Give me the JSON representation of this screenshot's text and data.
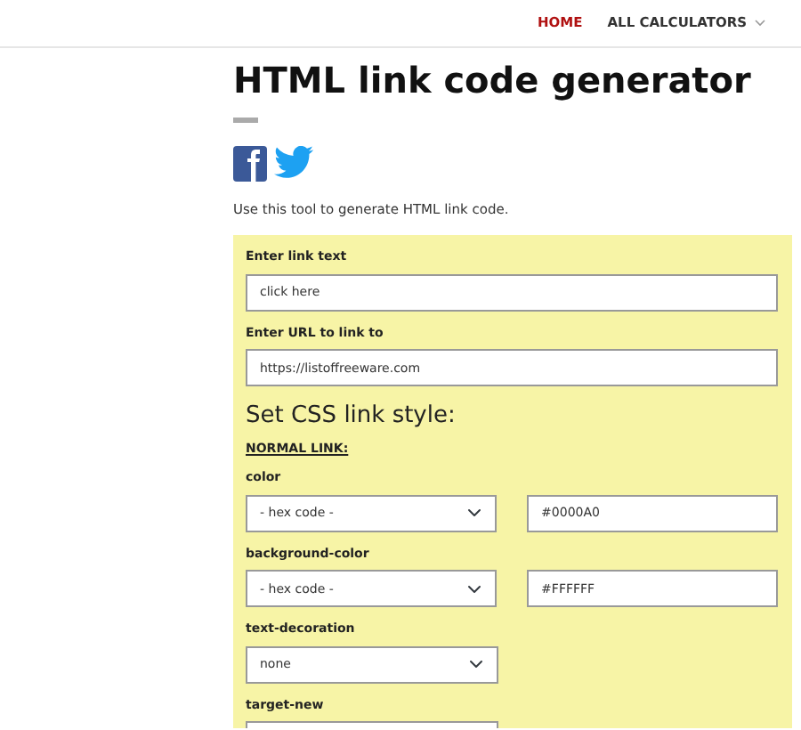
{
  "nav": [
    {
      "label": "HOME",
      "selected": true,
      "dropdown": false
    },
    {
      "label": "ALL CALCULATORS",
      "selected": false,
      "dropdown": true
    }
  ],
  "title": "HTML link code generator",
  "share": [
    {
      "kind": "facebook"
    },
    {
      "kind": "twitter"
    }
  ],
  "intro": "Use this tool to generate HTML link code.",
  "form": {
    "inputs": [
      {
        "label": "Enter link text",
        "value": "click here"
      },
      {
        "label": "Enter URL to link to",
        "value": "https://listoffreeware.com"
      }
    ],
    "heading": "Set CSS link style:",
    "subheading": "NORMAL LINK:",
    "properties": [
      {
        "kind": "hex",
        "label": "color",
        "select": "- hex code -",
        "value": "#0000A0"
      },
      {
        "kind": "hex",
        "label": "background-color",
        "select": "- hex code -",
        "value": "#FFFFFF"
      },
      {
        "kind": "select",
        "label": "text-decoration",
        "select": "none"
      },
      {
        "kind": "select",
        "label": "target-new"
      }
    ]
  }
}
